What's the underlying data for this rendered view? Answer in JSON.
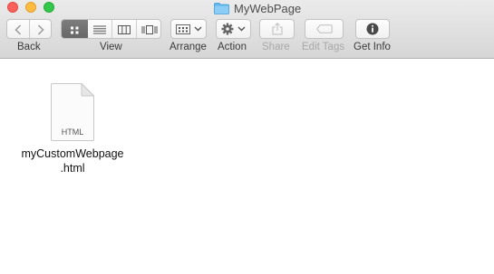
{
  "window": {
    "title": "MyWebPage",
    "folder_icon": "folder-icon",
    "traffic_lights": {
      "close_color": "#fc605b",
      "minimize_color": "#fdbc40",
      "maximize_color": "#34c84a"
    }
  },
  "toolbar": {
    "back_label": "Back",
    "view_label": "View",
    "arrange_label": "Arrange",
    "action_label": "Action",
    "share_label": "Share",
    "edit_tags_label": "Edit Tags",
    "get_info_label": "Get Info",
    "view_modes": [
      "icon-view-icon",
      "list-view-icon",
      "column-view-icon",
      "cover-flow-icon"
    ],
    "selected_view": "icon-view-icon"
  },
  "files": [
    {
      "name_line1": "myCustomWebpage",
      "name_line2": ".html",
      "type_badge": "HTML",
      "icon": "html-document-icon"
    }
  ]
}
